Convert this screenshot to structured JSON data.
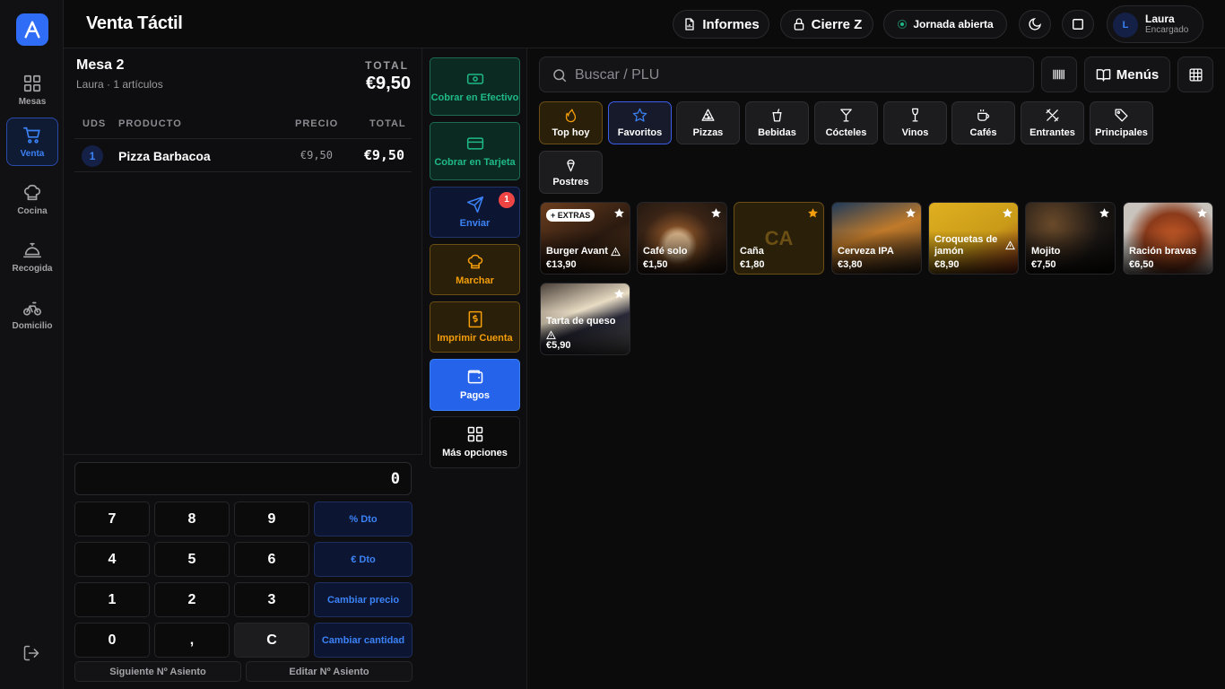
{
  "header": {
    "title": "Venta Táctil",
    "informes": "Informes",
    "cierre": "Cierre Z",
    "jornada": "Jornada abierta",
    "user": {
      "initial": "L",
      "name": "Laura",
      "role": "Encargado"
    }
  },
  "sidebar": {
    "logo": "A",
    "items": [
      {
        "label": "Mesas",
        "icon": "grid-icon"
      },
      {
        "label": "Venta",
        "icon": "cart-icon",
        "active": true
      },
      {
        "label": "Cocina",
        "icon": "chef-hat-icon"
      },
      {
        "label": "Recogida",
        "icon": "bell-icon"
      },
      {
        "label": "Domicilio",
        "icon": "bike-icon"
      }
    ]
  },
  "order": {
    "table": "Mesa 2",
    "subtitle": "Laura · 1 artículos",
    "total_label": "TOTAL",
    "total": "€9,50",
    "columns": {
      "uds": "UDS",
      "producto": "PRODUCTO",
      "precio": "PRECIO",
      "total": "TOTAL"
    },
    "items": [
      {
        "qty": "1",
        "name": "Pizza Barbacoa",
        "price": "€9,50",
        "total": "€9,50"
      }
    ]
  },
  "keypad": {
    "display": "0",
    "keys": [
      "7",
      "8",
      "9",
      "4",
      "5",
      "6",
      "1",
      "2",
      "3",
      "0",
      ",",
      "C"
    ],
    "side": [
      "% Dto",
      "€ Dto",
      "Cambiar precio",
      "Cambiar cantidad"
    ],
    "bottom": [
      "Siguiente Nº Asiento",
      "Editar Nº Asiento"
    ]
  },
  "actions": {
    "cash": "Cobrar en Efectivo",
    "card": "Cobrar en Tarjeta",
    "send": "Enviar",
    "send_badge": "1",
    "march": "Marchar",
    "print": "Imprimir Cuenta",
    "pay": "Pagos",
    "more": "Más opciones"
  },
  "catalog": {
    "search_placeholder": "Buscar / PLU",
    "menus": "Menús",
    "categories": [
      "Top hoy",
      "Favoritos",
      "Pizzas",
      "Bebidas",
      "Cócteles",
      "Vinos",
      "Cafés",
      "Entrantes",
      "Principales",
      "Postres"
    ],
    "extras_tag": "+ EXTRAS",
    "placeholder_initials": "CA",
    "products": [
      {
        "name": "Burger Avant",
        "price": "€13,90",
        "favorite": false
      },
      {
        "name": "Café solo",
        "price": "€1,50",
        "favorite": false
      },
      {
        "name": "Caña",
        "price": "€1,80",
        "favorite": true
      },
      {
        "name": "Cerveza IPA",
        "price": "€3,80",
        "favorite": false
      },
      {
        "name": "Croquetas de jamón",
        "price": "€8,90",
        "favorite": false
      },
      {
        "name": "Mojito",
        "price": "€7,50",
        "favorite": false
      },
      {
        "name": "Ración bravas",
        "price": "€6,50",
        "favorite": false
      },
      {
        "name": "Tarta de queso",
        "price": "€5,90",
        "favorite": false
      }
    ]
  },
  "colors": {
    "accent": "#2f6df6",
    "green": "#1fba85",
    "amber": "#f59e0b",
    "danger": "#ef4444"
  }
}
